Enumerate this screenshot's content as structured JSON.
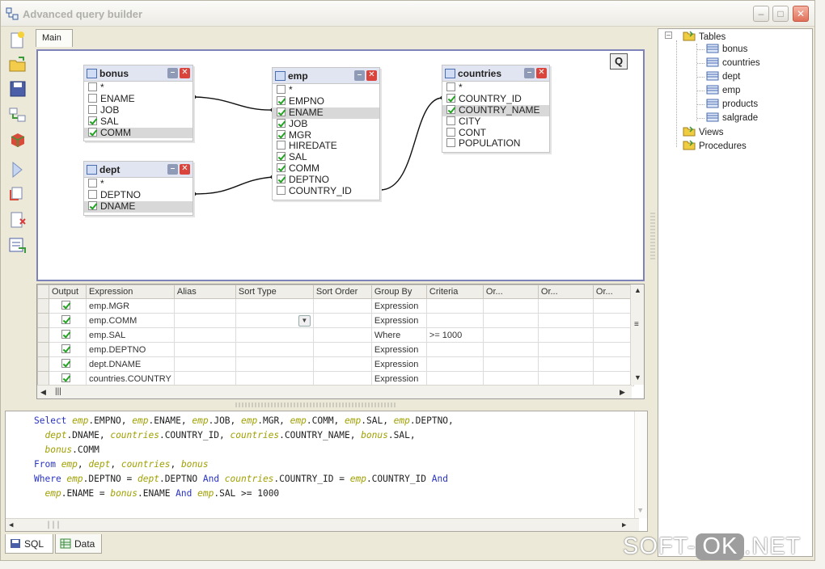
{
  "window": {
    "title": "Advanced query builder"
  },
  "designer": {
    "main_tab": "Main",
    "q_button": "Q",
    "tables": [
      {
        "name": "bonus",
        "fields": [
          {
            "label": "*",
            "checked": false,
            "selected": false
          },
          {
            "label": "ENAME",
            "checked": false,
            "selected": false
          },
          {
            "label": "JOB",
            "checked": false,
            "selected": false
          },
          {
            "label": "SAL",
            "checked": true,
            "selected": false
          },
          {
            "label": "COMM",
            "checked": true,
            "selected": true
          }
        ]
      },
      {
        "name": "dept",
        "fields": [
          {
            "label": "*",
            "checked": false,
            "selected": false
          },
          {
            "label": "DEPTNO",
            "checked": false,
            "selected": false
          },
          {
            "label": "DNAME",
            "checked": true,
            "selected": true
          }
        ]
      },
      {
        "name": "emp",
        "fields": [
          {
            "label": "*",
            "checked": false,
            "selected": false
          },
          {
            "label": "EMPNO",
            "checked": true,
            "selected": false
          },
          {
            "label": "ENAME",
            "checked": true,
            "selected": true
          },
          {
            "label": "JOB",
            "checked": true,
            "selected": false
          },
          {
            "label": "MGR",
            "checked": true,
            "selected": false
          },
          {
            "label": "HIREDATE",
            "checked": false,
            "selected": false
          },
          {
            "label": "SAL",
            "checked": true,
            "selected": false
          },
          {
            "label": "COMM",
            "checked": true,
            "selected": false
          },
          {
            "label": "DEPTNO",
            "checked": true,
            "selected": false
          },
          {
            "label": "COUNTRY_ID",
            "checked": false,
            "selected": false
          }
        ]
      },
      {
        "name": "countries",
        "fields": [
          {
            "label": "*",
            "checked": false,
            "selected": false
          },
          {
            "label": "COUNTRY_ID",
            "checked": true,
            "selected": false
          },
          {
            "label": "COUNTRY_NAME",
            "checked": true,
            "selected": true
          },
          {
            "label": "CITY",
            "checked": false,
            "selected": false
          },
          {
            "label": "CONT",
            "checked": false,
            "selected": false
          },
          {
            "label": "POPULATION",
            "checked": false,
            "selected": false
          }
        ]
      }
    ]
  },
  "grid": {
    "columns": [
      "Output",
      "Expression",
      "Alias",
      "Sort Type",
      "Sort Order",
      "Group By",
      "Criteria",
      "Or...",
      "Or...",
      "Or..."
    ],
    "rows": [
      {
        "output": true,
        "expression": "emp.MGR",
        "alias": "",
        "sort_type": "",
        "sort_order": "",
        "group_by": "Expression",
        "criteria": ""
      },
      {
        "output": true,
        "expression": "emp.COMM",
        "alias": "",
        "sort_type": "",
        "sort_order": "",
        "group_by": "Expression",
        "criteria": ""
      },
      {
        "output": true,
        "expression": "emp.SAL",
        "alias": "",
        "sort_type": "",
        "sort_order": "",
        "group_by": "Where",
        "criteria": ">= 1000"
      },
      {
        "output": true,
        "expression": "emp.DEPTNO",
        "alias": "",
        "sort_type": "",
        "sort_order": "",
        "group_by": "Expression",
        "criteria": ""
      },
      {
        "output": true,
        "expression": "dept.DNAME",
        "alias": "",
        "sort_type": "",
        "sort_order": "",
        "group_by": "Expression",
        "criteria": ""
      },
      {
        "output": true,
        "expression": "countries.COUNTRY",
        "alias": "",
        "sort_type": "",
        "sort_order": "",
        "group_by": "Expression",
        "criteria": ""
      }
    ]
  },
  "sql": {
    "lines": [
      [
        [
          "kw",
          "Select "
        ],
        [
          "tbl",
          "emp"
        ],
        [
          "t",
          ".EMPNO, "
        ],
        [
          "tbl",
          "emp"
        ],
        [
          "t",
          ".ENAME, "
        ],
        [
          "tbl",
          "emp"
        ],
        [
          "t",
          ".JOB, "
        ],
        [
          "tbl",
          "emp"
        ],
        [
          "t",
          ".MGR, "
        ],
        [
          "tbl",
          "emp"
        ],
        [
          "t",
          ".COMM, "
        ],
        [
          "tbl",
          "emp"
        ],
        [
          "t",
          ".SAL, "
        ],
        [
          "tbl",
          "emp"
        ],
        [
          "t",
          ".DEPTNO,"
        ]
      ],
      [
        [
          "t",
          "  "
        ],
        [
          "tbl",
          "dept"
        ],
        [
          "t",
          ".DNAME, "
        ],
        [
          "tbl",
          "countries"
        ],
        [
          "t",
          ".COUNTRY_ID, "
        ],
        [
          "tbl",
          "countries"
        ],
        [
          "t",
          ".COUNTRY_NAME, "
        ],
        [
          "tbl",
          "bonus"
        ],
        [
          "t",
          ".SAL,"
        ]
      ],
      [
        [
          "t",
          "  "
        ],
        [
          "tbl",
          "bonus"
        ],
        [
          "t",
          ".COMM"
        ]
      ],
      [
        [
          "kw",
          "From "
        ],
        [
          "tbl",
          "emp"
        ],
        [
          "t",
          ", "
        ],
        [
          "tbl",
          "dept"
        ],
        [
          "t",
          ", "
        ],
        [
          "tbl",
          "countries"
        ],
        [
          "t",
          ", "
        ],
        [
          "tbl",
          "bonus"
        ]
      ],
      [
        [
          "kw",
          "Where "
        ],
        [
          "tbl",
          "emp"
        ],
        [
          "t",
          ".DEPTNO = "
        ],
        [
          "tbl",
          "dept"
        ],
        [
          "t",
          ".DEPTNO "
        ],
        [
          "kw",
          "And "
        ],
        [
          "tbl",
          "countries"
        ],
        [
          "t",
          ".COUNTRY_ID = "
        ],
        [
          "tbl",
          "emp"
        ],
        [
          "t",
          ".COUNTRY_ID "
        ],
        [
          "kw",
          "And"
        ]
      ],
      [
        [
          "t",
          "  "
        ],
        [
          "tbl",
          "emp"
        ],
        [
          "t",
          ".ENAME = "
        ],
        [
          "tbl",
          "bonus"
        ],
        [
          "t",
          ".ENAME "
        ],
        [
          "kw",
          "And "
        ],
        [
          "tbl",
          "emp"
        ],
        [
          "t",
          ".SAL >= 1000"
        ]
      ]
    ]
  },
  "bottom_tabs": [
    "SQL",
    "Data"
  ],
  "tree": {
    "root": "Tables",
    "tables": [
      "bonus",
      "countries",
      "dept",
      "emp",
      "products",
      "salgrade"
    ],
    "views": "Views",
    "procedures": "Procedures"
  },
  "watermark": {
    "left": "SOFT-",
    "ok": "OK",
    "right": ".NET"
  }
}
